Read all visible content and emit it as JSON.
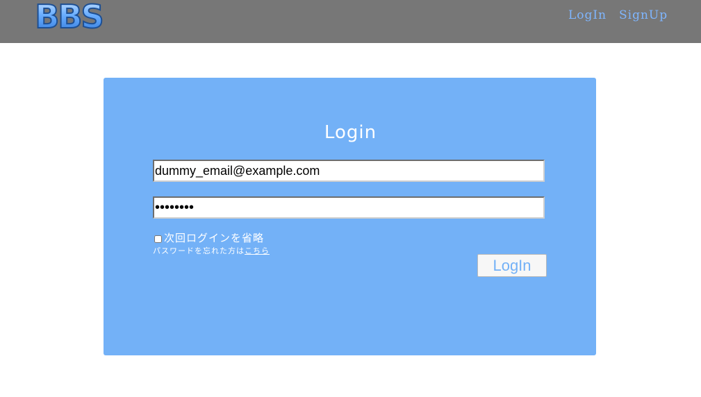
{
  "header": {
    "logo_text": "BBS",
    "nav": {
      "login_label": "LogIn",
      "signup_label": "SignUp"
    }
  },
  "login_form": {
    "title": "Login",
    "email_value": "dummy_email@example.com",
    "password_value": "••••••••",
    "remember_label": "次回ログインを省略",
    "remember_checked": false,
    "forgot_prefix": "パスワードを忘れた方は",
    "forgot_link": "こちら",
    "submit_label": "LogIn"
  },
  "colors": {
    "header_bg": "#777777",
    "nav_link": "#7fb6ff",
    "panel_bg": "#73b1f7",
    "button_text": "#73b1f7"
  }
}
